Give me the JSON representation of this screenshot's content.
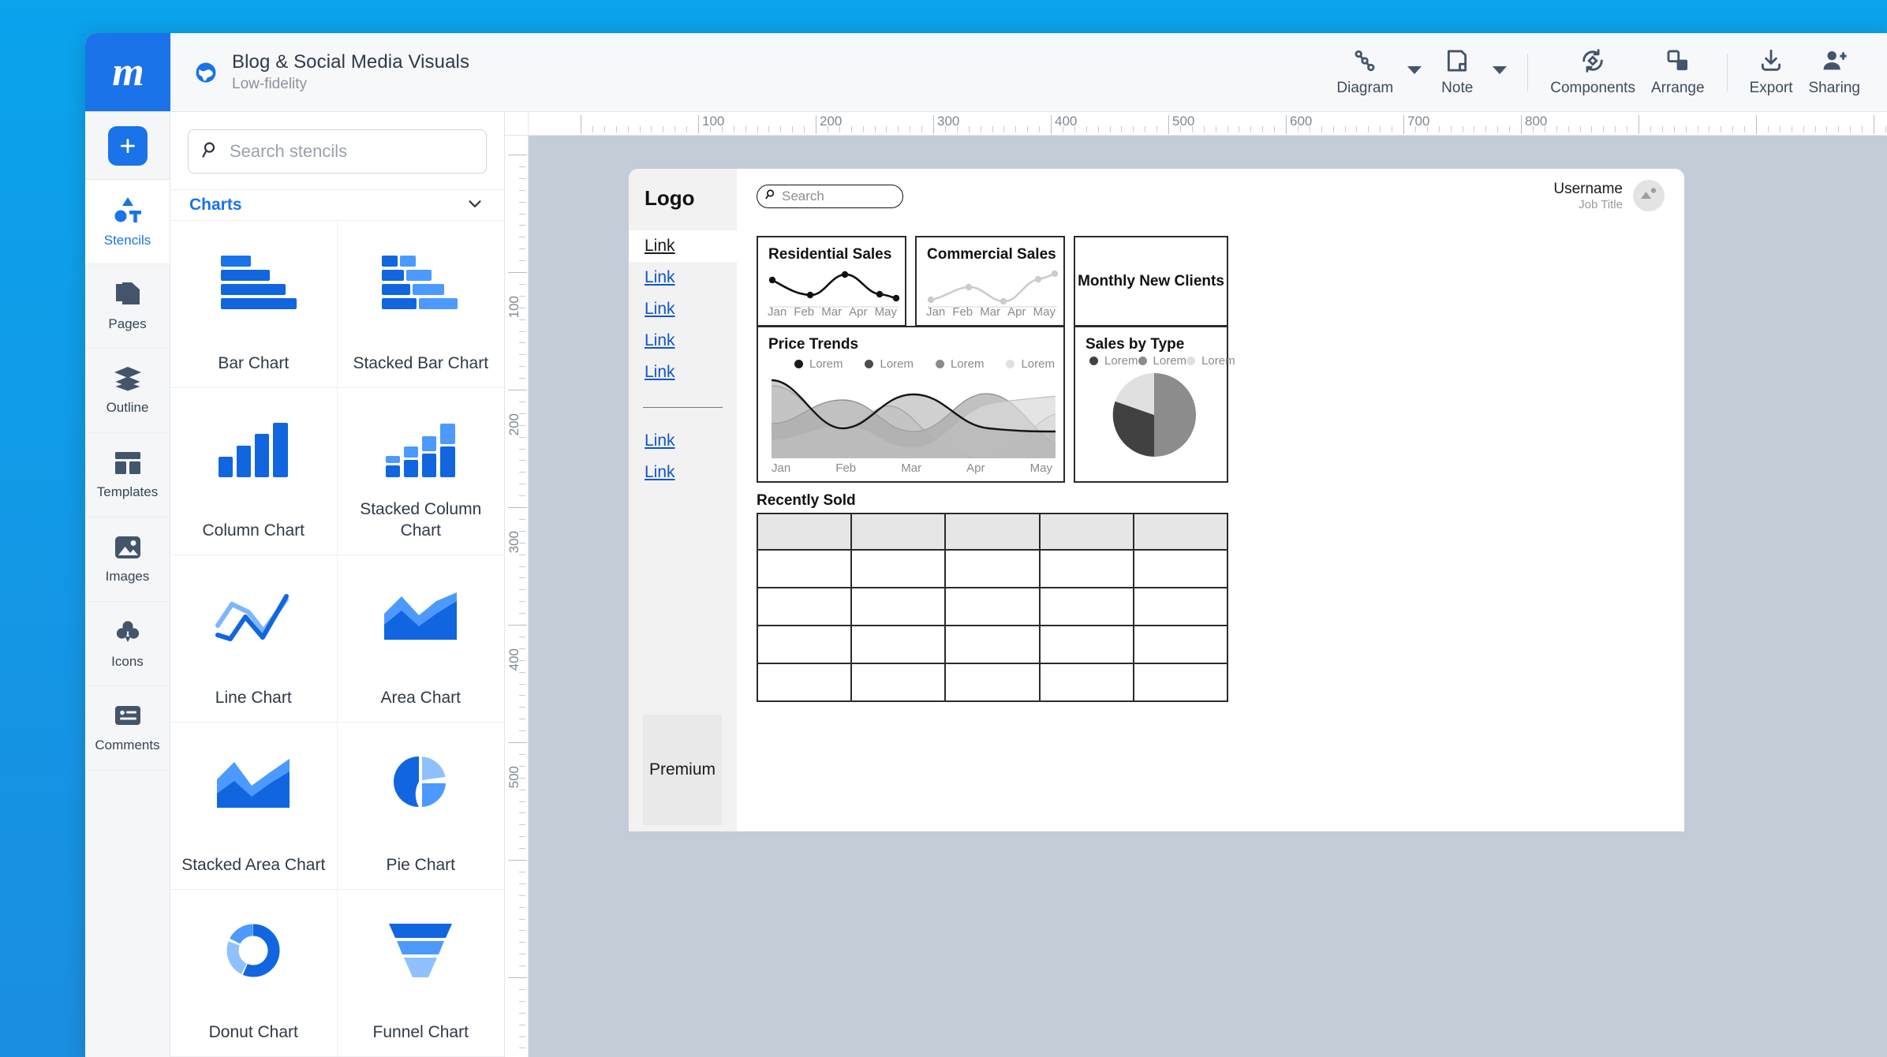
{
  "app": {
    "brand_logo": "m",
    "brand_color": "#1a73e8",
    "document_title": "Blog & Social Media Visuals",
    "document_subtitle": "Low-fidelity",
    "globe_icon": "globe-icon"
  },
  "toolbar": {
    "items": [
      {
        "label": "Diagram",
        "icon": "diagram-icon",
        "has_caret": true
      },
      {
        "label": "Note",
        "icon": "note-icon",
        "has_caret": true
      },
      {
        "label": "Components",
        "icon": "components-icon",
        "has_caret": false
      },
      {
        "label": "Arrange",
        "icon": "arrange-icon",
        "has_caret": false
      },
      {
        "label": "Export",
        "icon": "export-icon",
        "has_caret": false
      },
      {
        "label": "Sharing",
        "icon": "sharing-icon",
        "has_caret": false
      }
    ]
  },
  "rail": {
    "add_label": "plus-icon",
    "items": [
      {
        "label": "Stencils",
        "icon": "stencils-icon",
        "active": true
      },
      {
        "label": "Pages",
        "icon": "pages-icon",
        "active": false
      },
      {
        "label": "Outline",
        "icon": "outline-icon",
        "active": false
      },
      {
        "label": "Templates",
        "icon": "templates-icon",
        "active": false
      },
      {
        "label": "Images",
        "icon": "images-icon",
        "active": false
      },
      {
        "label": "Icons",
        "icon": "icons-icon",
        "active": false
      },
      {
        "label": "Comments",
        "icon": "comments-icon",
        "active": false
      }
    ]
  },
  "stencil_panel": {
    "search_placeholder": "Search stencils",
    "search_icon": "search-icon",
    "group_label": "Charts",
    "group_collapse_icon": "chevron-down-icon",
    "items": [
      {
        "label": "Bar Chart",
        "icon": "bar-chart-icon"
      },
      {
        "label": "Stacked Bar Chart",
        "icon": "stacked-bar-chart-icon"
      },
      {
        "label": "Column Chart",
        "icon": "column-chart-icon"
      },
      {
        "label": "Stacked Column Chart",
        "icon": "stacked-column-chart-icon"
      },
      {
        "label": "Line Chart",
        "icon": "line-chart-icon"
      },
      {
        "label": "Area Chart",
        "icon": "area-chart-icon"
      },
      {
        "label": "Stacked Area Chart",
        "icon": "stacked-area-chart-icon"
      },
      {
        "label": "Pie Chart",
        "icon": "pie-chart-icon"
      },
      {
        "label": "Donut Chart",
        "icon": "donut-chart-icon"
      },
      {
        "label": "Funnel Chart",
        "icon": "funnel-chart-icon"
      }
    ]
  },
  "ruler": {
    "horizontal_labels": [
      "100",
      "200",
      "300",
      "400",
      "500",
      "600",
      "700",
      "800"
    ],
    "vertical_labels": [
      "100",
      "200",
      "300",
      "400",
      "500"
    ]
  },
  "wireframe": {
    "logo": "Logo",
    "nav_links": [
      "Link",
      "Link",
      "Link",
      "Link",
      "Link"
    ],
    "nav_links_secondary": [
      "Link",
      "Link"
    ],
    "premium_label": "Premium",
    "search_placeholder": "Search",
    "search_icon": "search-icon",
    "user_name": "Username",
    "user_job_title": "Job Title",
    "avatar_icon": "image-placeholder-icon",
    "cards": {
      "residential": "Residential Sales",
      "commercial": "Commercial Sales",
      "monthly_new_clients": "Monthly New Clients",
      "price_trends": "Price Trends",
      "sales_by_type": "Sales by Type"
    },
    "recently_sold_title": "Recently Sold",
    "table": {
      "columns": 5,
      "header_cells": [
        "",
        "",
        "",
        "",
        ""
      ],
      "rows": [
        [
          "",
          "",
          "",
          "",
          ""
        ],
        [
          "",
          "",
          "",
          "",
          ""
        ],
        [
          "",
          "",
          "",
          "",
          ""
        ],
        [
          "",
          "",
          "",
          "",
          ""
        ]
      ]
    }
  },
  "chart_data": [
    {
      "type": "line",
      "title": "Residential Sales",
      "categories": [
        "Jan",
        "Feb",
        "Mar",
        "Apr",
        "May"
      ],
      "values": [
        62,
        30,
        80,
        30,
        22
      ],
      "series": [
        {
          "name": "Residential Sales",
          "values": [
            62,
            30,
            80,
            30,
            22
          ]
        }
      ],
      "color": "#111111",
      "xlabel": "",
      "ylabel": "",
      "ylim": [
        0,
        100
      ],
      "grid": false,
      "legend": "none",
      "markers": true
    },
    {
      "type": "line",
      "title": "Commercial Sales",
      "categories": [
        "Jan",
        "Feb",
        "Mar",
        "Apr",
        "May"
      ],
      "values": [
        14,
        40,
        5,
        62,
        78
      ],
      "series": [
        {
          "name": "Commercial Sales",
          "values": [
            14,
            40,
            5,
            62,
            78
          ]
        }
      ],
      "color": "#cccccc",
      "xlabel": "",
      "ylabel": "",
      "ylim": [
        0,
        100
      ],
      "grid": false,
      "legend": "none",
      "markers": true
    },
    {
      "type": "area",
      "title": "Price Trends",
      "categories": [
        "Jan",
        "Feb",
        "Mar",
        "Apr",
        "May"
      ],
      "legend": [
        "Lorem",
        "Lorem",
        "Lorem",
        "Lorem"
      ],
      "legend_colors": [
        "#1a1a1a",
        "#4d4d4d",
        "#8c8c8c",
        "#e0e0e0"
      ],
      "legend_position": "top",
      "series": [
        {
          "name": "Lorem",
          "color": "#1a1a1a",
          "values": [
            60,
            26,
            68,
            34,
            22
          ]
        },
        {
          "name": "Lorem",
          "color": "#4d4d4d",
          "values": [
            20,
            74,
            36,
            78,
            2
          ]
        },
        {
          "name": "Lorem",
          "color": "#8c8c8c",
          "values": [
            48,
            60,
            28,
            70,
            44
          ]
        },
        {
          "name": "Lorem",
          "color": "#e0e0e0",
          "values": [
            12,
            30,
            14,
            72,
            58
          ]
        }
      ],
      "xlabel": "",
      "ylabel": "",
      "ylim": [
        0,
        100
      ],
      "grid": false
    },
    {
      "type": "pie",
      "title": "Sales by Type",
      "legend": [
        "Lorem",
        "Lorem",
        "Lorem"
      ],
      "legend_position": "top",
      "labels": [
        "Lorem",
        "Lorem",
        "Lorem"
      ],
      "values": [
        50,
        30,
        20
      ],
      "colors": [
        "#8c8c8c",
        "#414141",
        "#e0e0e0"
      ]
    }
  ]
}
